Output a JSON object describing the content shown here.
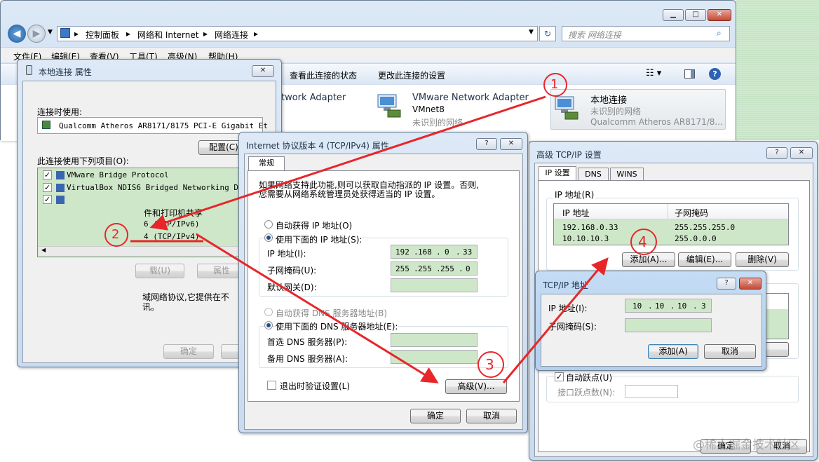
{
  "explorer": {
    "address": [
      "控制面板",
      "网络和 Internet",
      "网络连接"
    ],
    "search_placeholder": "搜索 网络连接",
    "menu": [
      "文件(F)",
      "编辑(E)",
      "查看(V)",
      "工具(T)",
      "高级(N)",
      "帮助(H)"
    ],
    "toolbar": [
      "查看此连接的状态",
      "更改此连接的设置"
    ],
    "adapter_partial": "twork Adapter",
    "vmnet": {
      "name": "VMware Network Adapter",
      "sub": "VMnet8",
      "status": "未识别的网络"
    },
    "local": {
      "name": "本地连接",
      "status": "未识别的网络",
      "device": "Qualcomm Atheros AR8171/8..."
    }
  },
  "props": {
    "title": "本地连接 属性",
    "connect_using": "连接时使用:",
    "device": "Qualcomm Atheros AR8171/8175 PCI-E Gigabit Et",
    "configure": "配置(C)",
    "items_label": "此连接使用下列项目(O):",
    "items": [
      {
        "text": "VMware Bridge Protocol",
        "checked": "✓"
      },
      {
        "text": "VirtualBox NDIS6 Bridged Networking Drive",
        "checked": "✓"
      },
      {
        "text": "",
        "checked": "✓"
      }
    ],
    "partial_items": [
      "件和打印机共享",
      "6 (TCP/IPv6)",
      "4 (TCP/IPv4)"
    ],
    "install": "载(U)",
    "properties": "属性",
    "desc": "域网络协议,它提供在不",
    "desc2": "讯。",
    "ok": "确定"
  },
  "ipv4": {
    "title": "Internet 协议版本 4 (TCP/IPv4) 属性",
    "tab": "常规",
    "intro": "如果网络支持此功能,则可以获取自动指派的 IP 设置。否则,",
    "intro2": "您需要从网络系统管理员处获得适当的 IP 设置。",
    "auto_ip": "自动获得 IP 地址(O)",
    "manual_ip": "使用下面的 IP 地址(S):",
    "ip_label": "IP 地址(I):",
    "ip": [
      "192",
      "168",
      "0",
      "33"
    ],
    "mask_label": "子网掩码(U):",
    "mask": [
      "255",
      "255",
      "255",
      "0"
    ],
    "gw_label": "默认网关(D):",
    "auto_dns": "自动获得 DNS 服务器地址(B)",
    "manual_dns": "使用下面的 DNS 服务器地址(E):",
    "dns1": "首选 DNS 服务器(P):",
    "dns2": "备用 DNS 服务器(A):",
    "validate": "退出时验证设置(L)",
    "advanced": "高级(V)...",
    "ok": "确定",
    "cancel": "取消"
  },
  "adv": {
    "title": "高级 TCP/IP 设置",
    "tabs": [
      "IP 设置",
      "DNS",
      "WINS"
    ],
    "group": "IP 地址(R)",
    "col_ip": "IP 地址",
    "col_mask": "子网掩码",
    "rows": [
      {
        "ip": "192.168.0.33",
        "mask": "255.255.255.0"
      },
      {
        "ip": "10.10.10.3",
        "mask": "255.0.0.0"
      }
    ],
    "add": "添加(A)...",
    "edit": "编辑(E)...",
    "remove": "删除(V)",
    "auto_metric": "自动跃点(U)",
    "metric_label": "接口跃点数(N):",
    "ok": "确定",
    "cancel": "取消"
  },
  "tcpip": {
    "title": "TCP/IP 地址",
    "ip_label": "IP 地址(I):",
    "ip": [
      "10",
      "10",
      "10",
      "3"
    ],
    "mask_label": "子网掩码(S):",
    "add": "添加(A)",
    "cancel": "取消"
  },
  "annot": [
    "1",
    "2",
    "3",
    "4"
  ],
  "watermark": "@稀土掘金技术社区",
  "colors": {
    "arrow": "#e8262a",
    "accent": "#1f4f8c"
  }
}
